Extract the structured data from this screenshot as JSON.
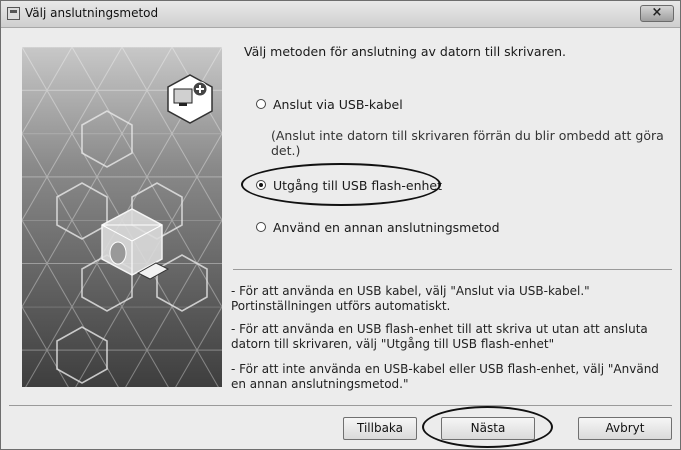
{
  "window": {
    "title": "Välj anslutningsmetod",
    "close_label": "×"
  },
  "main": {
    "prompt": "Välj metoden för anslutning av datorn till skrivaren.",
    "options": [
      {
        "label": "Anslut via USB-kabel",
        "selected": false
      },
      {
        "label": "Utgång till USB flash-enhet",
        "selected": true
      },
      {
        "label": "Använd en annan anslutningsmetod",
        "selected": false
      }
    ],
    "usb_note": "(Anslut inte datorn till skrivaren förrän du blir ombedd att göra det.)"
  },
  "info": [
    {
      "line1": "- För att använda en USB kabel, välj \"Anslut via USB-kabel.\"",
      "line2": "Portinställningen utförs automatiskt."
    },
    {
      "line1": "- För att använda en USB flash-enhet till att skriva ut utan att ansluta",
      "line2": "datorn till skrivaren, välj \"Utgång till USB flash-enhet\""
    },
    {
      "line1": "- För att inte använda en USB-kabel eller USB flash-enhet, välj \"Använd",
      "line2": "en annan anslutningsmetod.\""
    }
  ],
  "buttons": {
    "back": "Tillbaka",
    "next": "Nästa",
    "cancel": "Avbryt"
  },
  "colors": {
    "dialog_bg": "#ececec",
    "titlebar": "#d9d9d9",
    "panel_dark": "#5a5a5a",
    "highlight_ring": "#111111"
  }
}
